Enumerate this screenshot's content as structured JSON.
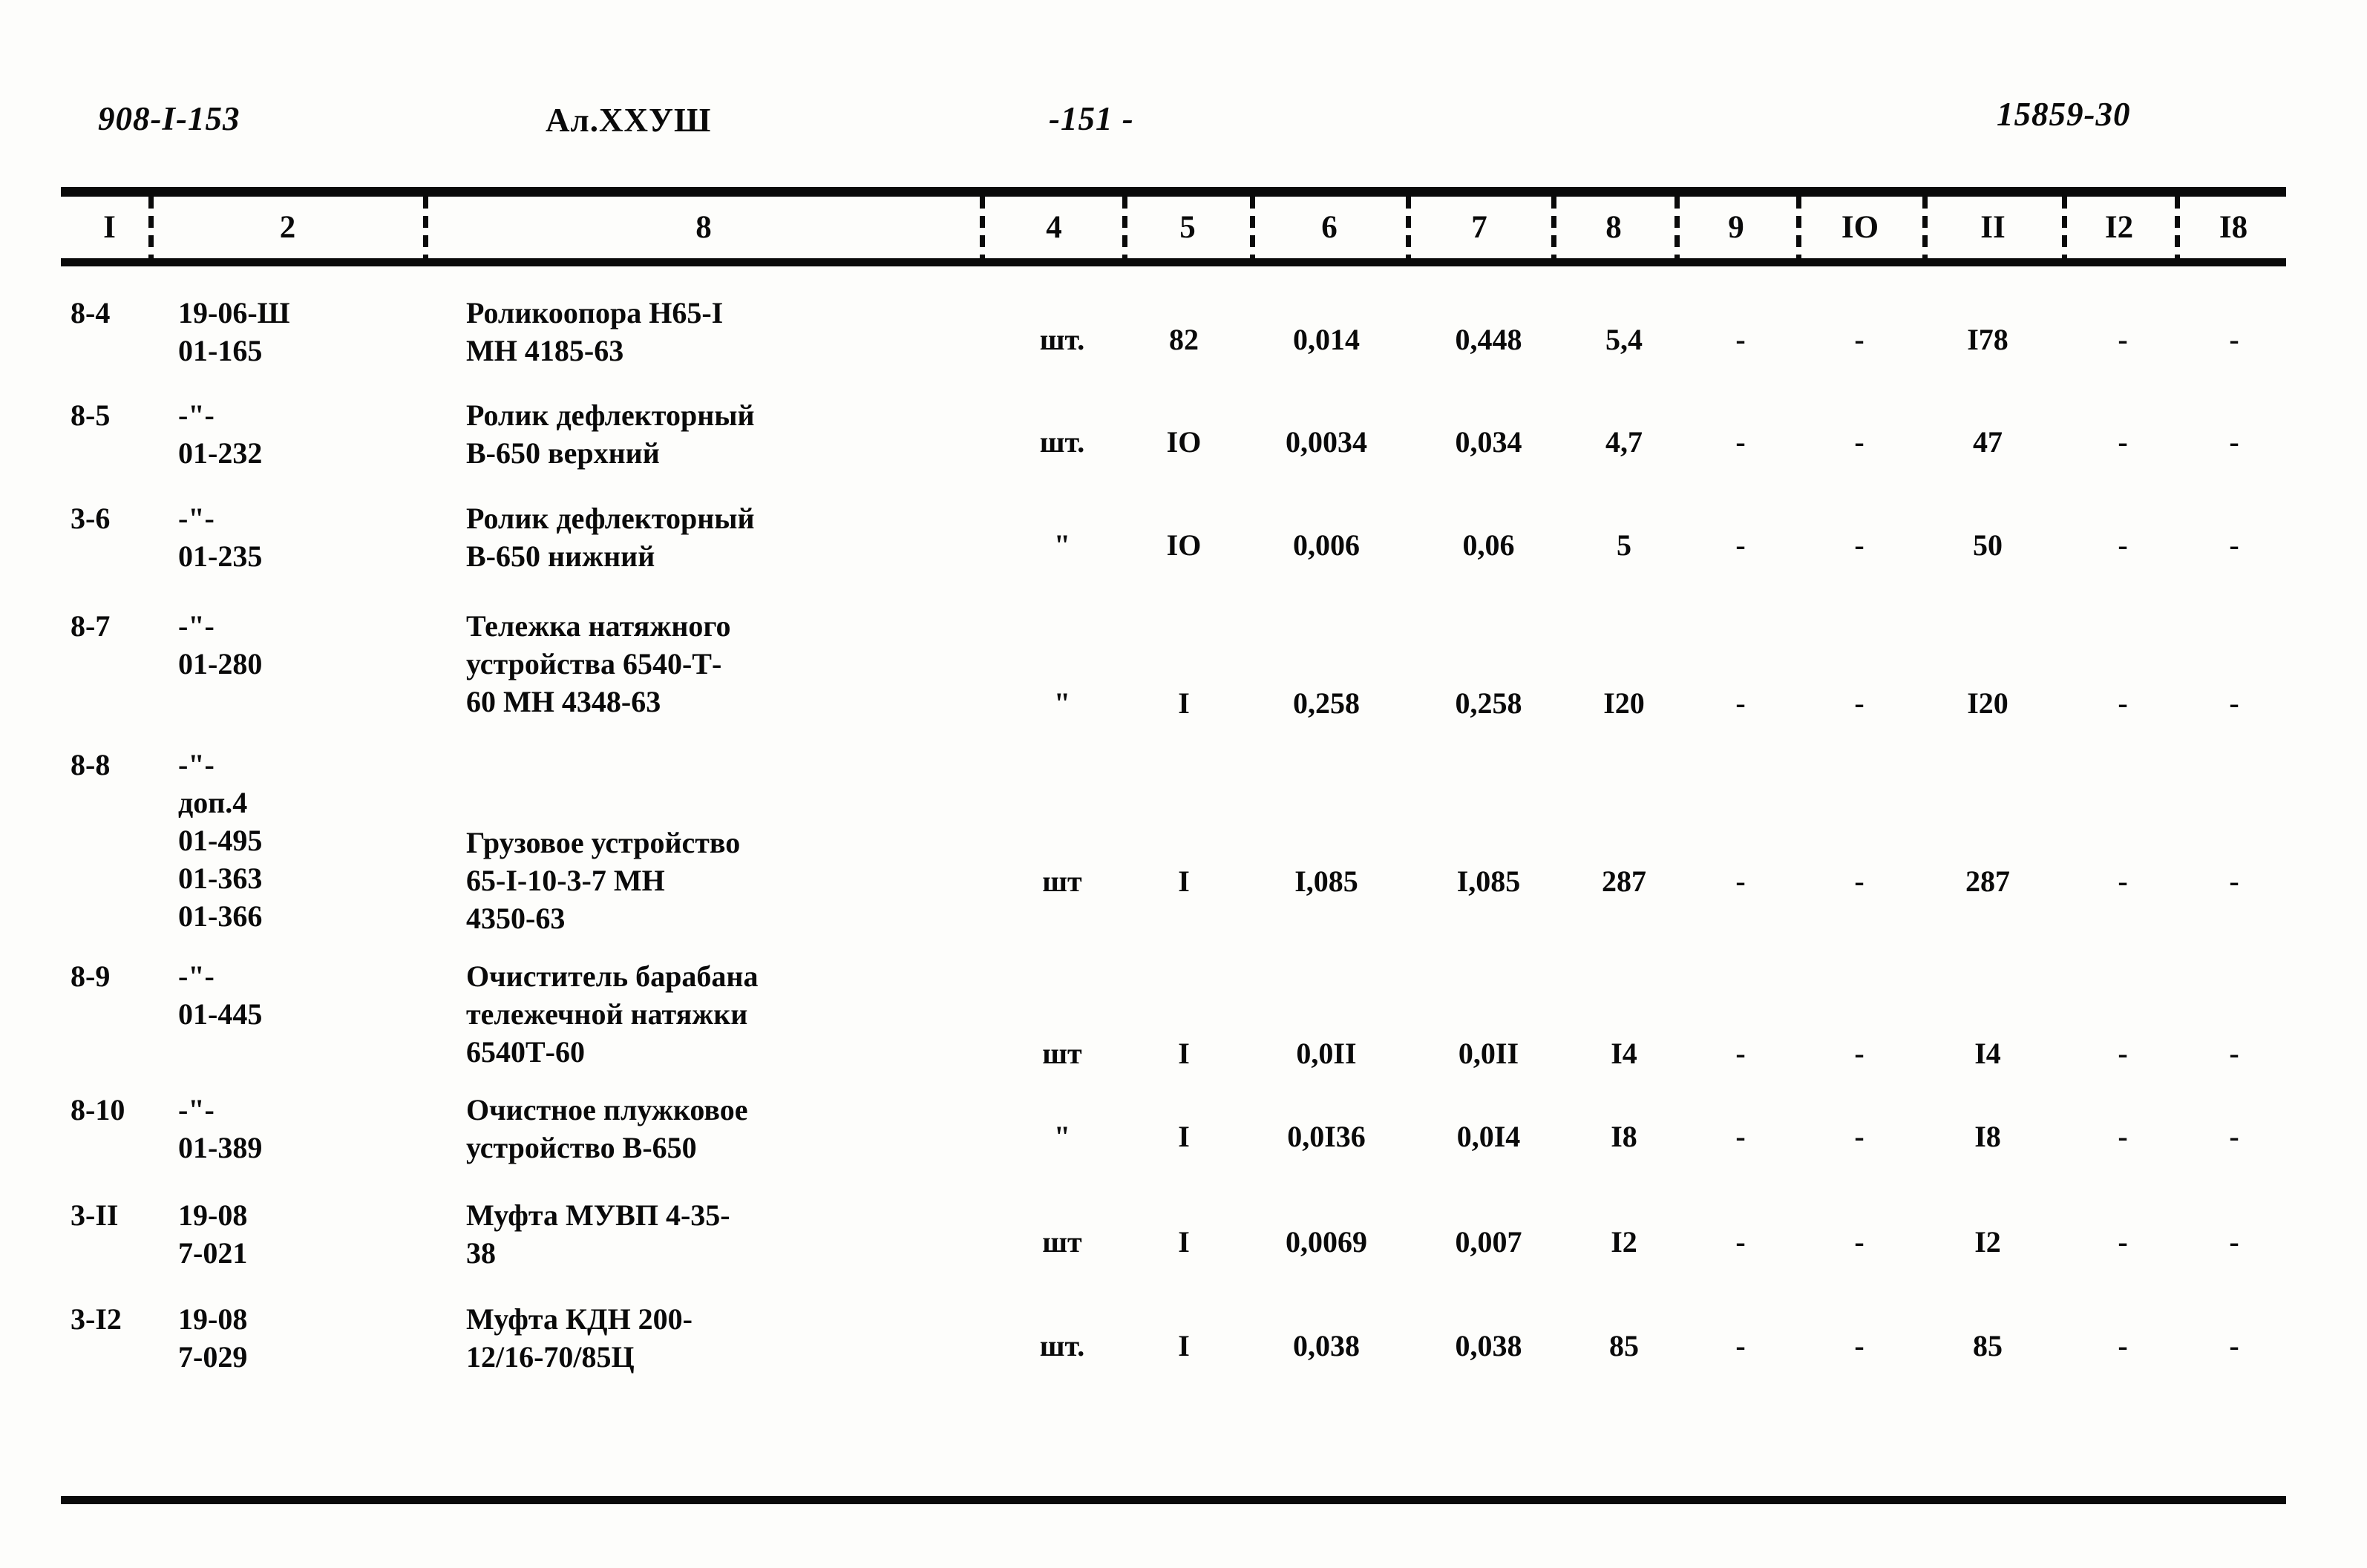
{
  "header": {
    "doc_code": "908-I-153",
    "album": "Ал.XXУШ",
    "page_number": "-151 -",
    "stamp": "15859-30"
  },
  "table": {
    "column_headers": [
      "I",
      "2",
      "8",
      "4",
      "5",
      "6",
      "7",
      "8",
      "9",
      "IO",
      "II",
      "I2",
      "I8"
    ],
    "rows": [
      {
        "pos": "8-4",
        "code": "19-06-Ш\n01-165",
        "name": "Роликоопора Н65-I\nМН 4185-63",
        "unit": "шт.",
        "c5": "82",
        "c6": "0,014",
        "c7": "0,448",
        "c8": "5,4",
        "c9": "-",
        "c10": "-",
        "c11": "I78",
        "c12": "-",
        "c13": "-"
      },
      {
        "pos": "8-5",
        "code": "-\"-\n01-232",
        "name": "Ролик дефлекторный\nВ-650 верхний",
        "unit": "шт.",
        "c5": "IO",
        "c6": "0,0034",
        "c7": "0,034",
        "c8": "4,7",
        "c9": "-",
        "c10": "-",
        "c11": "47",
        "c12": "-",
        "c13": "-"
      },
      {
        "pos": "3-6",
        "code": "-\"-\n01-235",
        "name": "Ролик дефлекторный\nВ-650 нижний",
        "unit": "\"",
        "c5": "IO",
        "c6": "0,006",
        "c7": "0,06",
        "c8": "5",
        "c9": "-",
        "c10": "-",
        "c11": "50",
        "c12": "-",
        "c13": "-"
      },
      {
        "pos": "8-7",
        "code": "-\"-\n01-280",
        "name": "Тележка натяжного\nустройства 6540-Т-\n60 МН 4348-63",
        "unit": "\"",
        "c5": "I",
        "c6": "0,258",
        "c7": "0,258",
        "c8": "I20",
        "c9": "-",
        "c10": "-",
        "c11": "I20",
        "c12": "-",
        "c13": "-"
      },
      {
        "pos": "8-8",
        "code": "-\"-\nдоп.4\n01-495\n01-363\n01-366",
        "name": "Грузовое устройство\n65-I-10-3-7 МН\n4350-63",
        "unit": "шт",
        "c5": "I",
        "c6": "I,085",
        "c7": "I,085",
        "c8": "287",
        "c9": "-",
        "c10": "-",
        "c11": "287",
        "c12": "-",
        "c13": "-"
      },
      {
        "pos": "8-9",
        "code": "-\"-\n01-445",
        "name": "Очиститель барабана\nтележечной натяжки\n6540Т-60",
        "unit": "шт",
        "c5": "I",
        "c6": "0,0II",
        "c7": "0,0II",
        "c8": "I4",
        "c9": "-",
        "c10": "-",
        "c11": "I4",
        "c12": "-",
        "c13": "-"
      },
      {
        "pos": "8-10",
        "code": "-\"-\n01-389",
        "name": "Очистное плужковое\nустройство В-650",
        "unit": "\"",
        "c5": "I",
        "c6": "0,0I36",
        "c7": "0,0I4",
        "c8": "I8",
        "c9": "-",
        "c10": "-",
        "c11": "I8",
        "c12": "-",
        "c13": "-"
      },
      {
        "pos": "3-II",
        "code": "19-08\n7-021",
        "name": "Муфта МУВП 4-35-\n38",
        "unit": "шт",
        "c5": "I",
        "c6": "0,0069",
        "c7": "0,007",
        "c8": "I2",
        "c9": "-",
        "c10": "-",
        "c11": "I2",
        "c12": "-",
        "c13": "-"
      },
      {
        "pos": "3-I2",
        "code": "19-08\n7-029",
        "name": "Муфта КДН 200-\n12/16-70/85Ц",
        "unit": "шт.",
        "c5": "I",
        "c6": "0,038",
        "c7": "0,038",
        "c8": "85",
        "c9": "-",
        "c10": "-",
        "c11": "85",
        "c12": "-",
        "c13": "-"
      }
    ]
  }
}
